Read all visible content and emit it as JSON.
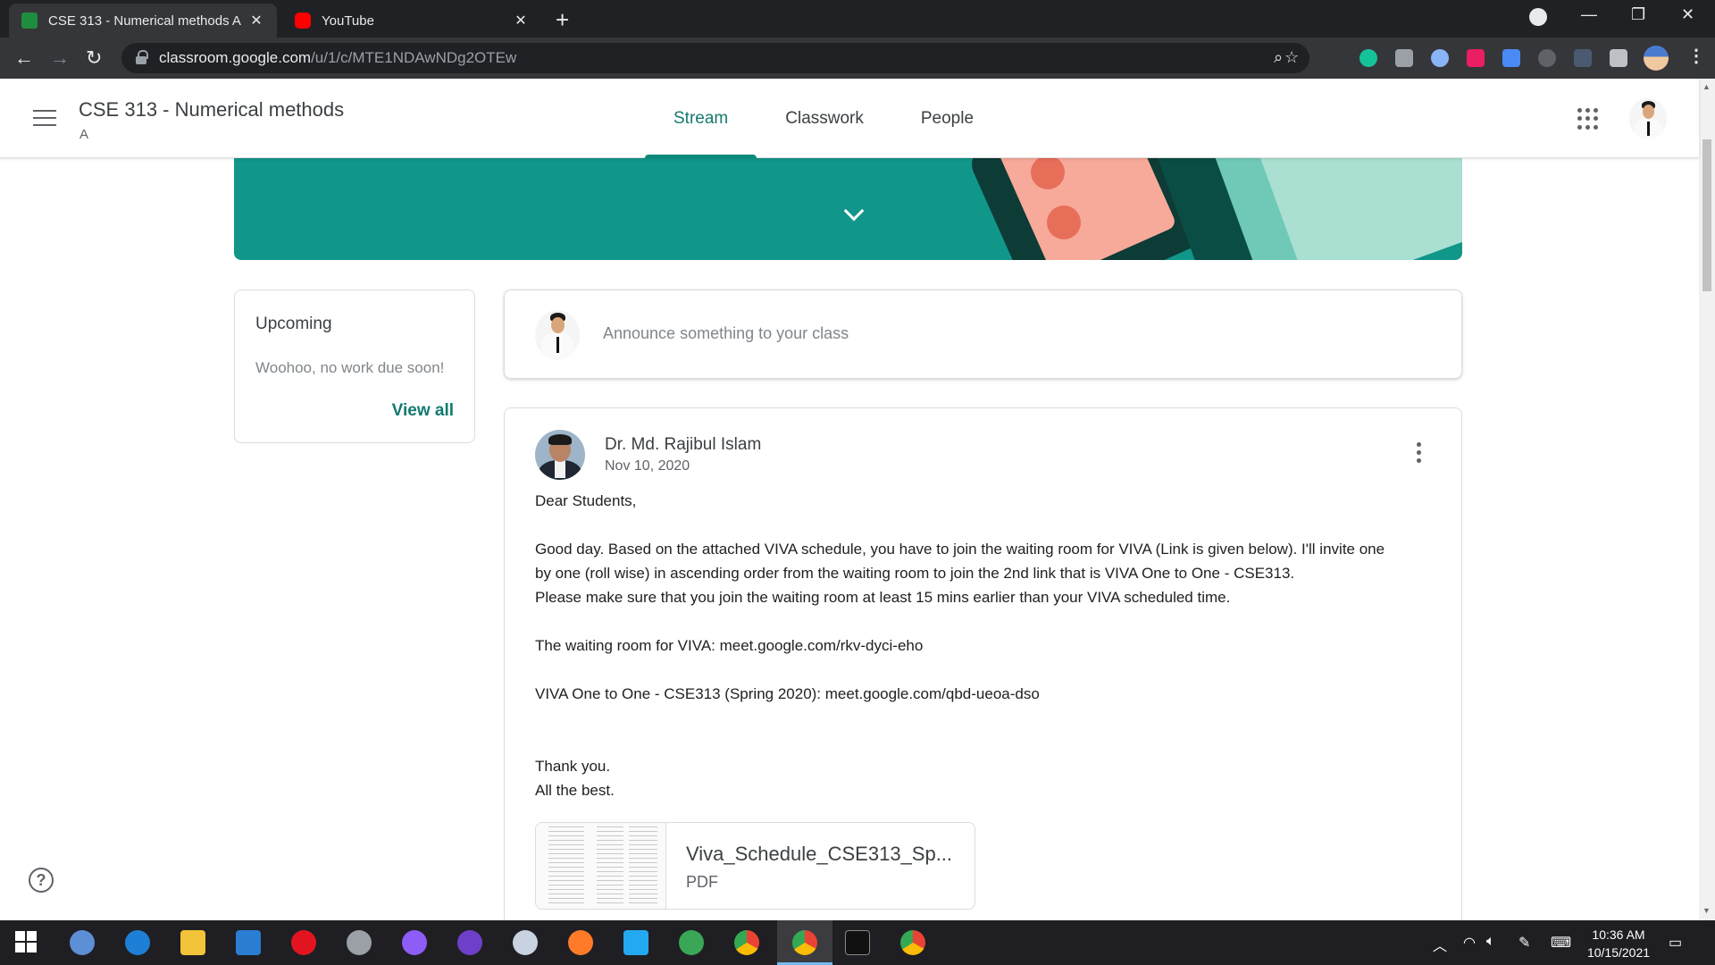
{
  "browser": {
    "tabs": [
      {
        "title": "CSE 313 - Numerical methods A",
        "active": true
      },
      {
        "title": "YouTube",
        "active": false
      }
    ],
    "url": {
      "host": "classroom.google.com",
      "path": "/u/1/c/MTE1NDAwNDg2OTEw"
    }
  },
  "header": {
    "class_title": "CSE 313 - Numerical methods",
    "section": "A",
    "tabs": [
      {
        "label": "Stream",
        "selected": true
      },
      {
        "label": "Classwork",
        "selected": false
      },
      {
        "label": "People",
        "selected": false
      }
    ]
  },
  "upcoming": {
    "title": "Upcoming",
    "empty_text": "Woohoo, no work due soon!",
    "view_all": "View all"
  },
  "announce": {
    "placeholder": "Announce something to your class"
  },
  "post": {
    "author": "Dr. Md. Rajibul Islam",
    "date": "Nov 10, 2020",
    "lines": [
      "Dear Students,",
      "Good day. Based on the attached VIVA schedule, you have to join the waiting room for VIVA (Link is given below). I'll invite one",
      "by one (roll wise) in ascending order from the waiting room to join the 2nd link that is VIVA One to One - CSE313.",
      "Please make sure that you join the waiting room at least 15 mins earlier than your VIVA scheduled time.",
      "The waiting room for VIVA: meet.google.com/rkv-dyci-eho",
      "VIVA One to One - CSE313 (Spring 2020): meet.google.com/qbd-ueoa-dso",
      "Thank you.",
      "All the best."
    ],
    "attachment": {
      "name": "Viva_Schedule_CSE313_Sp...",
      "type": "PDF"
    }
  },
  "taskbar": {
    "time": "10:36 AM",
    "date": "10/15/2021"
  },
  "colors": {
    "accent": "#137a6f",
    "banner": "#11968a",
    "chrome_dark": "#202124",
    "chrome_toolbar": "#35363a"
  }
}
